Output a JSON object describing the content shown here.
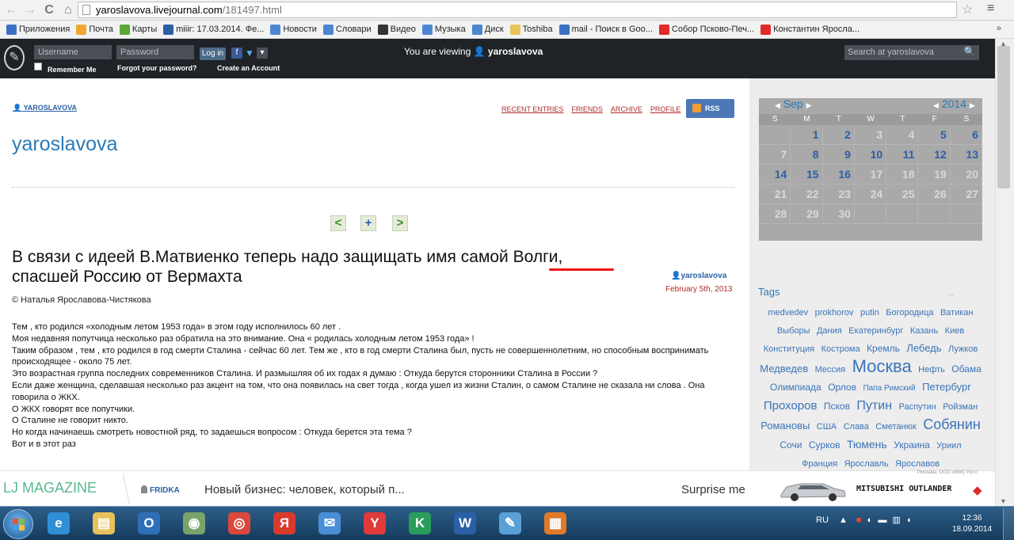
{
  "browser": {
    "url_host": "yaroslavova.livejournal.com",
    "url_path": "/181497.html",
    "bookmarks": [
      {
        "label": "Приложения",
        "color": "#3b70c4"
      },
      {
        "label": "Почта",
        "color": "#f0a830"
      },
      {
        "label": "Карты",
        "color": "#5aa83a"
      },
      {
        "label": "miiir: 17.03.2014. Фе...",
        "color": "#2a5fa6"
      },
      {
        "label": "Новости",
        "color": "#4c86d0"
      },
      {
        "label": "Словари",
        "color": "#4c86d0"
      },
      {
        "label": "Видео",
        "color": "#333333"
      },
      {
        "label": "Музыка",
        "color": "#4c86d0"
      },
      {
        "label": "Диск",
        "color": "#4c86d0"
      },
      {
        "label": "Toshiba",
        "color": "#e8c45a"
      },
      {
        "label": "mail - Поиск в Goo...",
        "color": "#3b70c4"
      },
      {
        "label": "Собор Псково-Печ...",
        "color": "#e02a2a"
      },
      {
        "label": "Константин Яросла...",
        "color": "#e02a2a"
      }
    ],
    "more": "»"
  },
  "lj_header": {
    "username_placeholder": "Username",
    "password_placeholder": "Password",
    "login_label": "Log in",
    "remember_me": "Remember Me",
    "forgot_password": "Forgot your password?",
    "create_account": "Create an Account",
    "viewing_prefix": "You are viewing",
    "viewing_user": "yaroslavova",
    "search_placeholder": "Search at yaroslavova"
  },
  "journal": {
    "user_link": "YAROSLAVOVA",
    "nav": [
      "RECENT ENTRIES",
      "FRIENDS",
      "ARCHIVE",
      "PROFILE"
    ],
    "rss": "RSS",
    "title": "yaroslavova"
  },
  "post": {
    "title_line1": "В связи с идеей В.Матвиенко теперь надо защищать имя самой Волги,",
    "title_line2": "спасшей Россию от Вермахта",
    "poster": "yaroslavova",
    "date": "February 5th, 2013",
    "copyright": "© Наталья Ярославова-Чистякова",
    "body": [
      "Тем , кто родился «холодным летом 1953 года» в этом году исполнилось 60 лет .",
      "Моя недавняя попутчица несколько раз обратила на это внимание. Она « родилась холодным летом 1953 года» !",
      "Таким образом , тем , кто родился в год смерти Сталина - сейчас 60 лет. Тем же , кто в год смерти Сталина был, пусть не совершеннолетним, но способным воспринимать происходящее - около 75 лет.",
      "Это возрастная группа последних современников Сталина. И размышляя об их годах я думаю : Откуда берутся сторонники Сталина в России ?",
      "Если даже женщина, сделавшая несколько раз акцент на том, что она появилась на свет тогда , когда ушел из жизни Сталин, о самом Сталине не сказала ни слова . Она говорила о ЖКХ.",
      "О ЖКХ говорят все попутчики.",
      "О Сталине не говорит никто.",
      "Но когда начинаешь смотреть новостной ряд, то задаешься вопросом : Откуда берется эта тема ?",
      "Вот и в этот раз"
    ]
  },
  "calendar": {
    "month": "Sep",
    "year": "2014",
    "weekdays": [
      "S",
      "M",
      "T",
      "W",
      "T",
      "F",
      "S"
    ],
    "days": [
      "",
      "1",
      "2",
      "3",
      "4",
      "5",
      "6",
      "7",
      "8",
      "9",
      "10",
      "11",
      "12",
      "13",
      "14",
      "15",
      "16",
      "17",
      "18",
      "19",
      "20",
      "21",
      "22",
      "23",
      "24",
      "25",
      "26",
      "27",
      "28",
      "29",
      "30",
      "",
      "",
      "",
      ""
    ],
    "linked_days": [
      "1",
      "2",
      "5",
      "6",
      "8",
      "9",
      "10",
      "11",
      "12",
      "13",
      "14",
      "15",
      "16"
    ]
  },
  "tags": {
    "heading": "Tags",
    "more": "...",
    "items": [
      {
        "t": "medvedev",
        "s": 11
      },
      {
        "t": "prokhorov",
        "s": 11
      },
      {
        "t": "putin",
        "s": 11
      },
      {
        "t": "Богородица",
        "s": 11
      },
      {
        "t": "Ватикан",
        "s": 11
      },
      {
        "t": "Выборы",
        "s": 11
      },
      {
        "t": "Дания",
        "s": 11
      },
      {
        "t": "Екатеринбург",
        "s": 11
      },
      {
        "t": "Казань",
        "s": 11
      },
      {
        "t": "Киев",
        "s": 11
      },
      {
        "t": "Конституция",
        "s": 11
      },
      {
        "t": "Кострома",
        "s": 11
      },
      {
        "t": "Кремль",
        "s": 12
      },
      {
        "t": "Лебедь",
        "s": 13
      },
      {
        "t": "Лужков",
        "s": 11
      },
      {
        "t": "Медведев",
        "s": 13
      },
      {
        "t": "Мессия",
        "s": 11
      },
      {
        "t": "Москва",
        "s": 22
      },
      {
        "t": "Нефть",
        "s": 11
      },
      {
        "t": "Обама",
        "s": 12
      },
      {
        "t": "Олимпиада",
        "s": 12
      },
      {
        "t": "Орлов",
        "s": 12
      },
      {
        "t": "Папа Римский",
        "s": 10
      },
      {
        "t": "Петербург",
        "s": 13
      },
      {
        "t": "Прохоров",
        "s": 15
      },
      {
        "t": "Псков",
        "s": 12
      },
      {
        "t": "Путин",
        "s": 16
      },
      {
        "t": "Распутин",
        "s": 11
      },
      {
        "t": "Ройзман",
        "s": 11
      },
      {
        "t": "Романовы",
        "s": 13
      },
      {
        "t": "США",
        "s": 11
      },
      {
        "t": "Слава",
        "s": 11
      },
      {
        "t": "Сметанюк",
        "s": 11
      },
      {
        "t": "Собянин",
        "s": 18
      },
      {
        "t": "Сочи",
        "s": 12
      },
      {
        "t": "Сурков",
        "s": 12
      },
      {
        "t": "Тюмень",
        "s": 14
      },
      {
        "t": "Украина",
        "s": 12
      },
      {
        "t": "Уриил",
        "s": 11
      },
      {
        "t": "Франция",
        "s": 11
      },
      {
        "t": "Ярославль",
        "s": 11
      },
      {
        "t": "Ярославов",
        "s": 11
      }
    ]
  },
  "magazine": {
    "title": "LJ MAGAZINE",
    "author": "FRIDKA",
    "teaser": "Новый бизнес: человек, который п...",
    "surprise": "Surprise me",
    "ad_text": "MITSUBISHI OUTLANDER",
    "ad_small": "Реклама. ООО «ММС Рус»"
  },
  "taskbar": {
    "apps": [
      {
        "name": "ie",
        "glyph": "e",
        "bg": "#2f8fd6"
      },
      {
        "name": "explorer",
        "glyph": "▤",
        "bg": "#e7c15a"
      },
      {
        "name": "outlook",
        "glyph": "O",
        "bg": "#2f6fb8"
      },
      {
        "name": "media",
        "glyph": "◉",
        "bg": "#7aa36a"
      },
      {
        "name": "chrome",
        "glyph": "◎",
        "bg": "#d9483b"
      },
      {
        "name": "yandex",
        "glyph": "Я",
        "bg": "#d93a2c"
      },
      {
        "name": "mail",
        "glyph": "✉",
        "bg": "#4a8fd6"
      },
      {
        "name": "yabrowser",
        "glyph": "Y",
        "bg": "#e03a3a"
      },
      {
        "name": "kaspersky",
        "glyph": "K",
        "bg": "#2a9d5a"
      },
      {
        "name": "word",
        "glyph": "W",
        "bg": "#2b5fa8"
      },
      {
        "name": "paint",
        "glyph": "✎",
        "bg": "#5aa0d8"
      },
      {
        "name": "other",
        "glyph": "▦",
        "bg": "#e07a2a"
      }
    ],
    "lang": "RU",
    "time": "12:36",
    "date": "18.09.2014"
  }
}
